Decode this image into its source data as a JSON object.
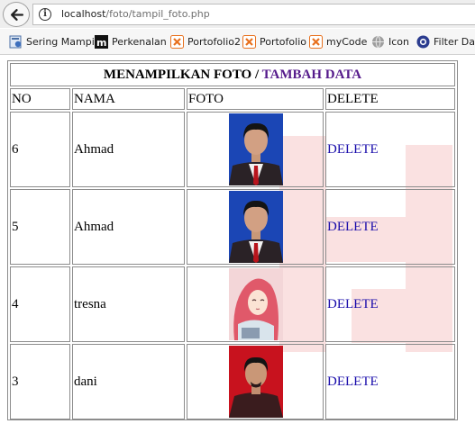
{
  "browser": {
    "url_host": "localhost",
    "url_path": "/foto/tampil_foto.php",
    "bookmarks": [
      {
        "label": "Sering Mampir",
        "icon": "bookmarks-icon"
      },
      {
        "label": "Perkenalan",
        "icon": "m-logo-icon"
      },
      {
        "label": "Portofolio2",
        "icon": "xampp-icon"
      },
      {
        "label": "Portofolio",
        "icon": "xampp-icon"
      },
      {
        "label": "myCode",
        "icon": "xampp-icon"
      },
      {
        "label": "Icon",
        "icon": "globe-icon"
      },
      {
        "label": "Filter Data",
        "icon": "camera-icon"
      }
    ]
  },
  "table": {
    "title": "MENAMPILKAN FOTO",
    "separator": "/",
    "add_link": "TAMBAH DATA",
    "headers": [
      "NO",
      "NAMA",
      "FOTO",
      "DELETE"
    ],
    "rows": [
      {
        "no": "6",
        "nama": "Ahmad",
        "photo": "man-suit-blue-bg",
        "delete": "DELETE"
      },
      {
        "no": "5",
        "nama": "Ahmad",
        "photo": "man-suit-blue-bg",
        "delete": "DELETE"
      },
      {
        "no": "4",
        "nama": "tresna",
        "photo": "woman-hijab-illustration",
        "delete": "DELETE"
      },
      {
        "no": "3",
        "nama": "dani",
        "photo": "man-red-bg",
        "delete": "DELETE"
      }
    ]
  },
  "colors": {
    "visited_link": "#551a8b",
    "link": "#1a0dab",
    "watermark": "#e02020"
  }
}
